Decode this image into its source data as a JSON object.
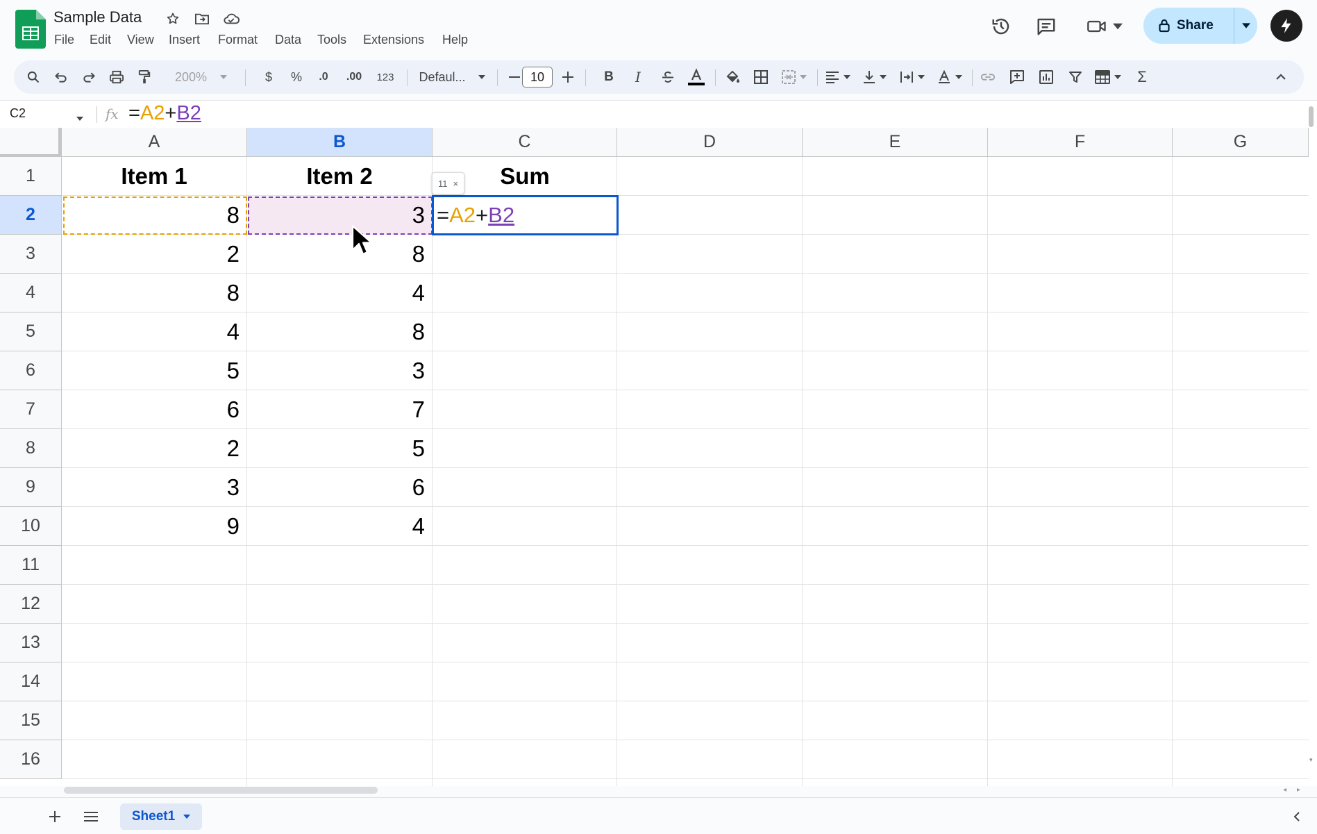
{
  "app": {
    "doc_title": "Sample Data",
    "menu": [
      "File",
      "Edit",
      "View",
      "Insert",
      "Format",
      "Data",
      "Tools",
      "Extensions",
      "Help"
    ],
    "share_label": "Share"
  },
  "toolbar": {
    "zoom": "200%",
    "currency": "$",
    "percent": "%",
    "decrease_decimal": ".0",
    "increase_decimal": ".00",
    "number_format": "123",
    "font": "Defaul...",
    "font_size": "10",
    "bold": "B",
    "italic": "I",
    "sum_symbol": "Σ"
  },
  "formula_bar": {
    "name_box": "C2",
    "fx_label": "fx",
    "eq": "=",
    "ref1": "A2",
    "op": "+",
    "ref2": "B2"
  },
  "grid": {
    "columns": [
      "A",
      "B",
      "C",
      "D",
      "E",
      "F",
      "G"
    ],
    "selected_column": "B",
    "rows": [
      "1",
      "2",
      "3",
      "4",
      "5",
      "6",
      "7",
      "8",
      "9",
      "10",
      "11",
      "12",
      "13",
      "14",
      "15",
      "16"
    ],
    "selected_row": "2",
    "headers": [
      "Item 1",
      "Item 2",
      "Sum"
    ],
    "col_a": [
      "8",
      "2",
      "8",
      "4",
      "5",
      "6",
      "2",
      "3",
      "9"
    ],
    "col_b": [
      "3",
      "8",
      "4",
      "8",
      "3",
      "7",
      "5",
      "6",
      "4"
    ],
    "active_cell": {
      "address": "C2",
      "eq": "=",
      "ref1": "A2",
      "op": "+",
      "ref2": "B2"
    },
    "preview_tooltip": {
      "value": "11",
      "close": "×"
    }
  },
  "bottom": {
    "sheet_name": "Sheet1"
  },
  "colors": {
    "accent": "#0b57d0",
    "ref_a": "#e8a000",
    "ref_b": "#7b3fb8",
    "share_bg": "#c2e7ff"
  }
}
